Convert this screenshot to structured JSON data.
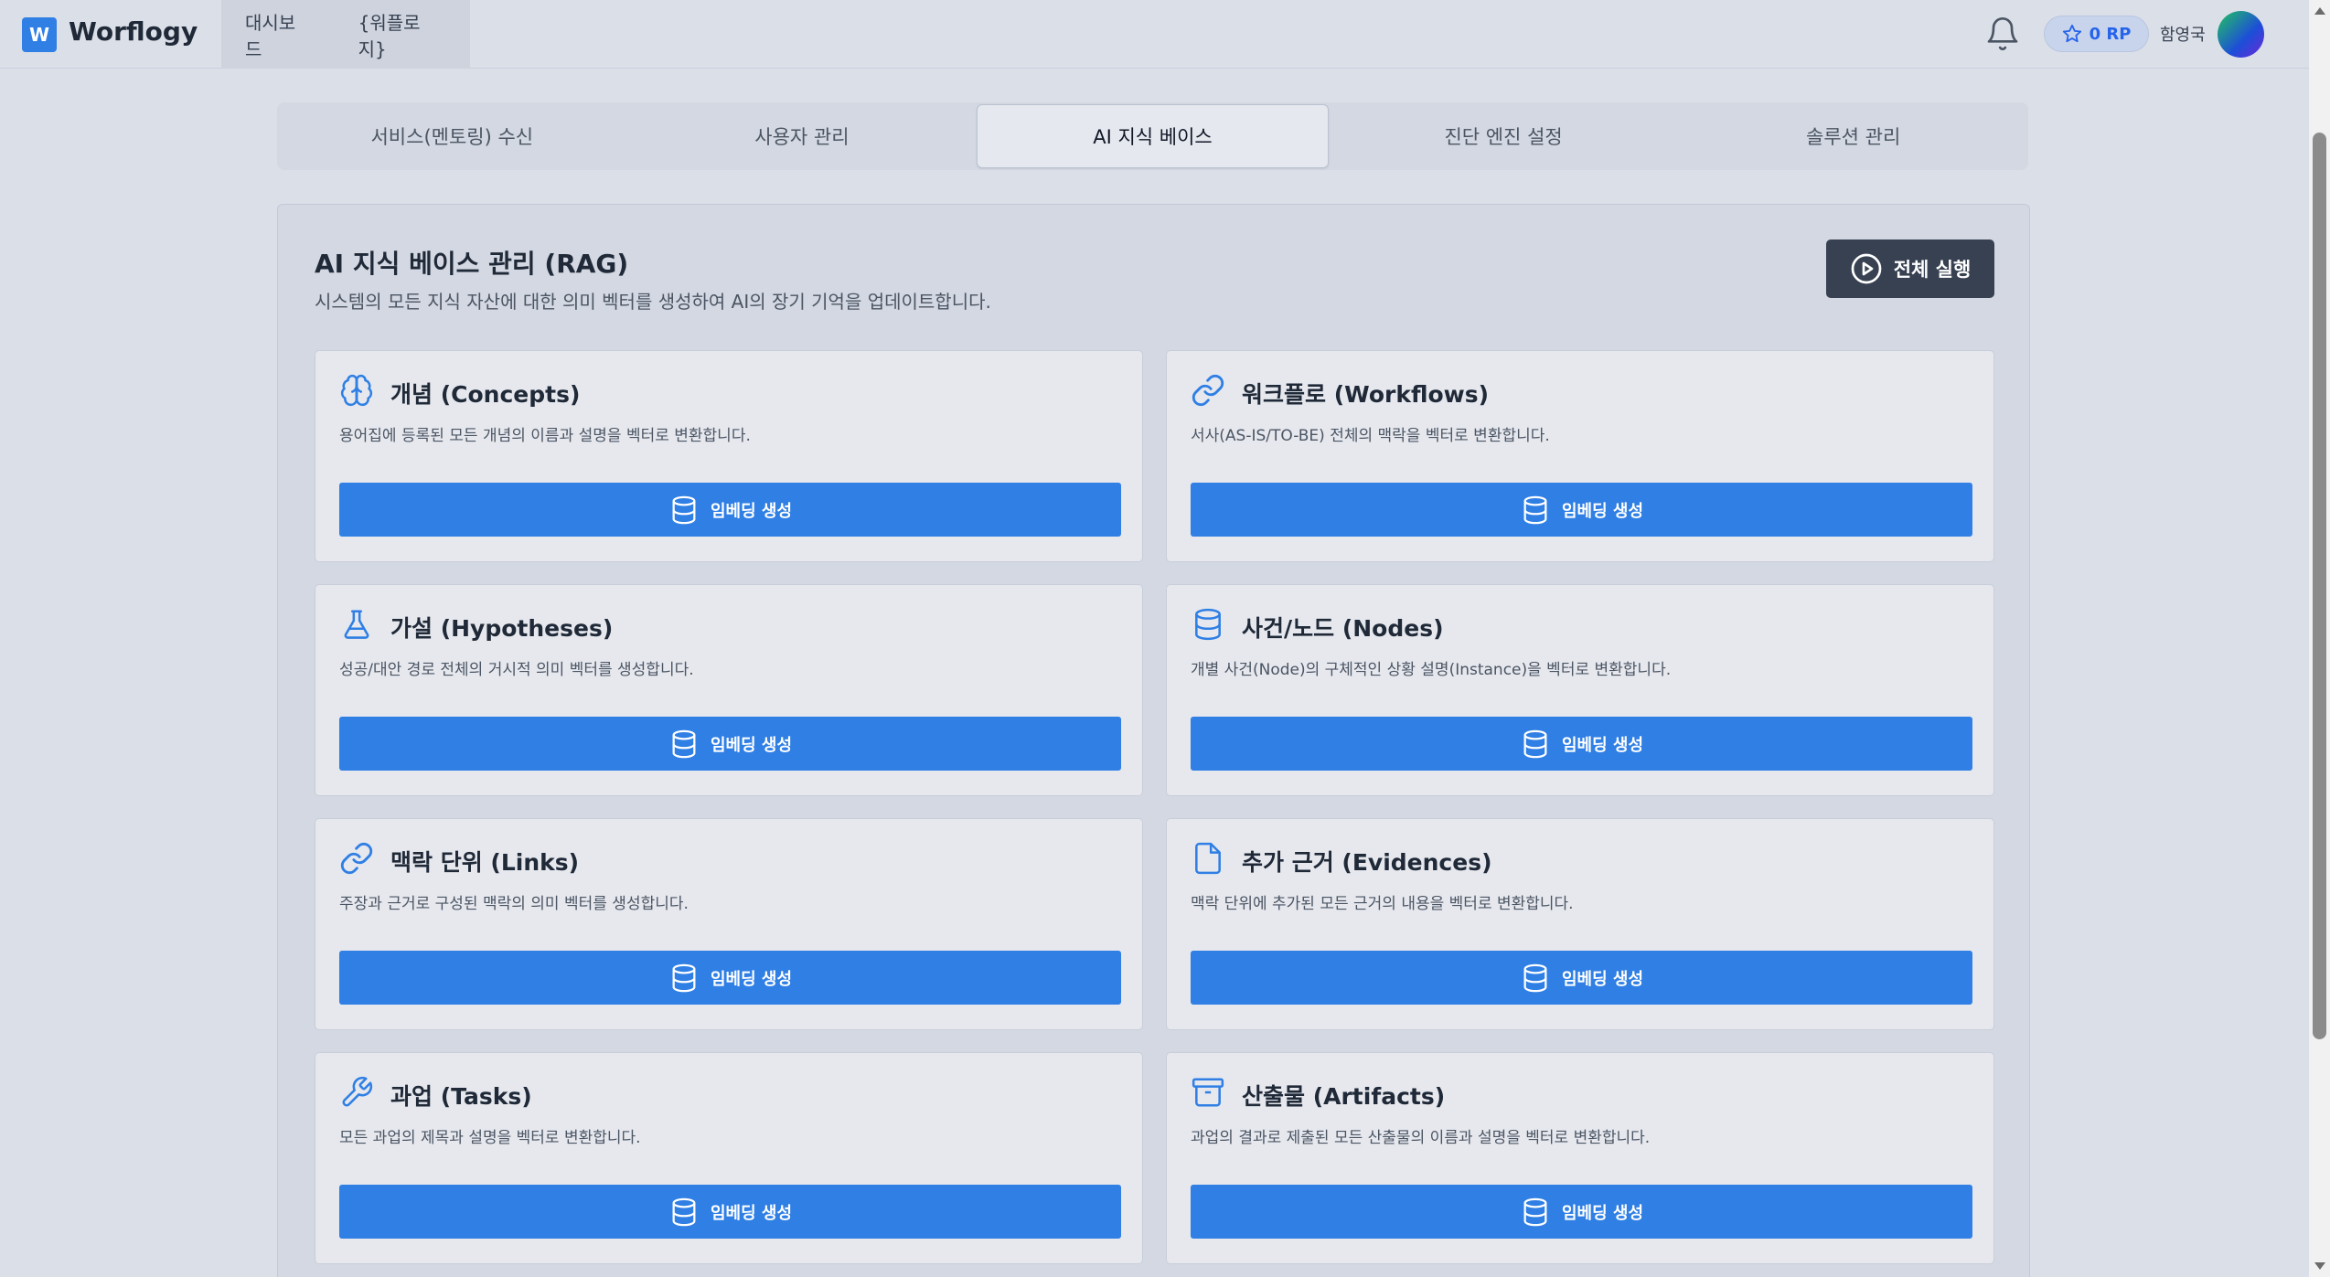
{
  "app": {
    "logo_letter": "W",
    "name": "Worflogy"
  },
  "nav": [
    "대시보드",
    "{워플로지}"
  ],
  "user": {
    "points": "0 RP",
    "name": "함영국"
  },
  "tabs": [
    {
      "label": "서비스(멘토링) 수신",
      "active": false
    },
    {
      "label": "사용자 관리",
      "active": false
    },
    {
      "label": "AI 지식 베이스",
      "active": true
    },
    {
      "label": "진단 엔진 설정",
      "active": false
    },
    {
      "label": "솔루션 관리",
      "active": false
    }
  ],
  "panel": {
    "title": "AI 지식 베이스 관리 (RAG)",
    "subtitle": "시스템의 모든 지식 자산에 대한 의미 벡터를 생성하여 AI의 장기 기억을 업데이트합니다.",
    "run_all_label": "전체 실행"
  },
  "embed_label": "임베딩 생성",
  "cards": [
    {
      "icon": "brain-icon",
      "title": "개념 (Concepts)",
      "desc": "용어집에 등록된 모든 개념의 이름과 설명을 벡터로 변환합니다."
    },
    {
      "icon": "link-icon",
      "title": "워크플로 (Workflows)",
      "desc": "서사(AS-IS/TO-BE) 전체의 맥락을 벡터로 변환합니다."
    },
    {
      "icon": "flask-icon",
      "title": "가설 (Hypotheses)",
      "desc": "성공/대안 경로 전체의 거시적 의미 벡터를 생성합니다."
    },
    {
      "icon": "database-icon",
      "title": "사건/노드 (Nodes)",
      "desc": "개별 사건(Node)의 구체적인 상황 설명(Instance)을 벡터로 변환합니다."
    },
    {
      "icon": "link-icon",
      "title": "맥락 단위 (Links)",
      "desc": "주장과 근거로 구성된 맥락의 의미 벡터를 생성합니다."
    },
    {
      "icon": "file-icon",
      "title": "추가 근거 (Evidences)",
      "desc": "맥락 단위에 추가된 모든 근거의 내용을 벡터로 변환합니다."
    },
    {
      "icon": "wrench-icon",
      "title": "과업 (Tasks)",
      "desc": "모든 과업의 제목과 설명을 벡터로 변환합니다."
    },
    {
      "icon": "archive-icon",
      "title": "산출물 (Artifacts)",
      "desc": "과업의 결과로 제출된 모든 산출물의 이름과 설명을 벡터로 변환합니다."
    }
  ],
  "colors": {
    "primary": "#2f7fe4",
    "dark_button": "#374151",
    "background": "#dbdfe8"
  }
}
